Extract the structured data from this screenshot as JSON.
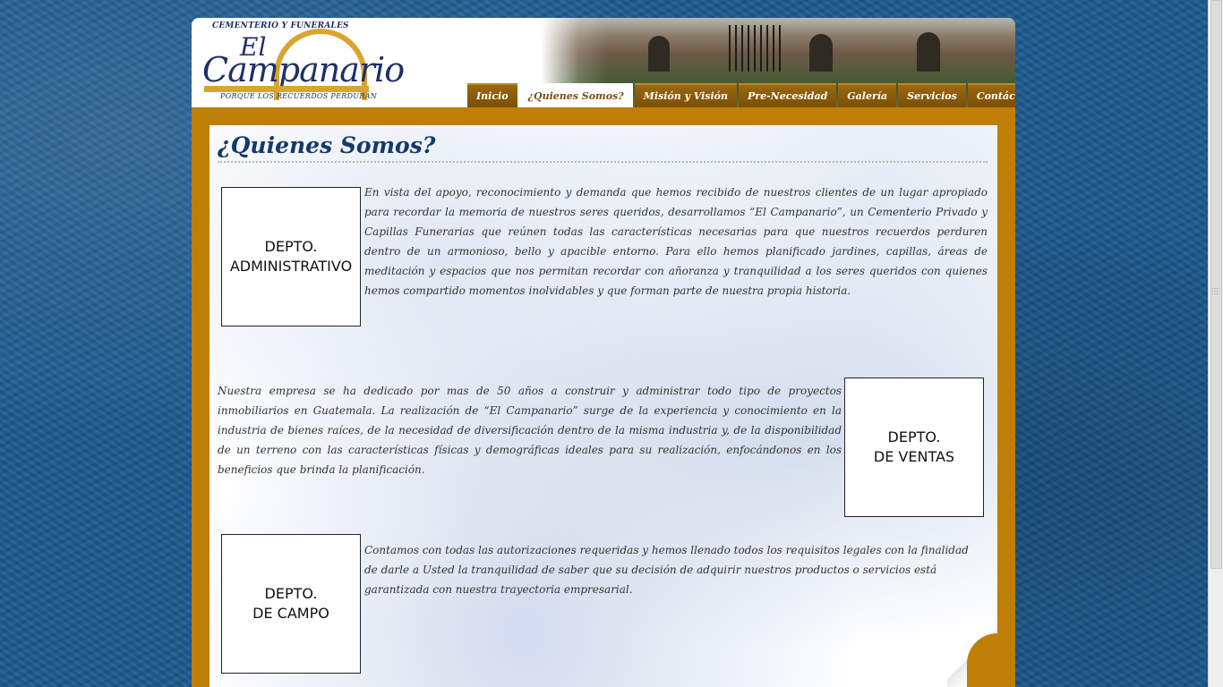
{
  "logo": {
    "top": "CEMENTERIO Y FUNERALES",
    "el": "El",
    "name": "Campanario",
    "tagline": "PORQUE LOS RECUERDOS PERDURAN"
  },
  "nav": [
    {
      "label": "Inicio",
      "active": false
    },
    {
      "label": "¿Quienes Somos?",
      "active": true
    },
    {
      "label": "Misión y Visión",
      "active": false
    },
    {
      "label": "Pre-Necesidad",
      "active": false
    },
    {
      "label": "Galería",
      "active": false
    },
    {
      "label": "Servicios",
      "active": false
    },
    {
      "label": "Contáctenos",
      "active": false
    }
  ],
  "page": {
    "title": "¿Quienes Somos?"
  },
  "sections": [
    {
      "box_line1": "DEPTO.",
      "box_line2": "ADMINISTRATIVO",
      "text": "En vista del apoyo, reconocimiento y demanda que hemos recibido de nuestros clientes de un lugar apropiado para recordar la memoria de nuestros seres queridos, desarrollamos “El Campanario”, un Cementerio Privado y Capillas Funerarias que reúnen todas las características necesarias para que nuestros recuerdos perduren dentro de un armonioso, bello y apacible entorno. Para ello hemos planificado jardines, capillas, áreas de meditación y espacios que nos permitan recordar con añoranza y tranquilidad a los seres queridos con quienes hemos compartido momentos inolvidables y que forman parte de nuestra propia historia."
    },
    {
      "box_line1": "DEPTO.",
      "box_line2": "DE VENTAS",
      "text": "Nuestra empresa se ha dedicado por mas de 50 años a construir y administrar todo tipo de proyectos inmobiliarios en Guatemala. La realización de “El Campanario” surge de la experiencia y conocimiento en la industria de bienes raíces, de la necesidad de diversificación dentro de la misma industria y, de la disponibilidad de un terreno con las características físicas y demográficas ideales para su realización, enfocándonos en los beneficios que brinda la planificación."
    },
    {
      "box_line1": "DEPTO.",
      "box_line2": "DE CAMPO",
      "text": "Contamos con todas las autorizaciones requeridas y hemos llenado todos los requisitos legales con la finalidad de darle a Usted la tranquilidad de saber que su decisión de adquirir nuestros productos o servicios está garantizada con nuestra trayectoria empresarial."
    }
  ],
  "colors": {
    "background": "#1c5a8e",
    "gold": "#bf7e05",
    "nav_brown": "#7a4f08",
    "title_blue": "#123b6b"
  }
}
